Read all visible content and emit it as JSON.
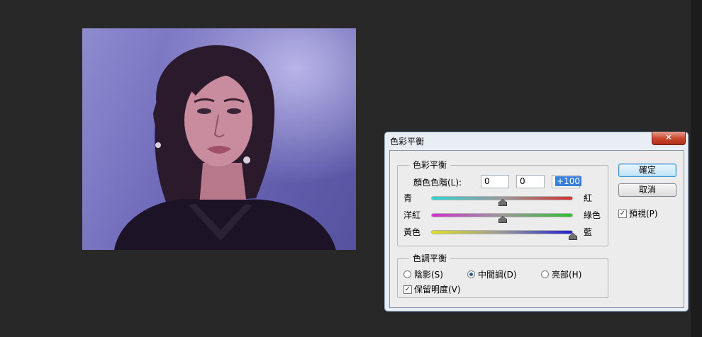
{
  "dialog": {
    "title": "色彩平衡",
    "close_label": "✕",
    "color_balance_group": {
      "label": "色彩平衡",
      "levels_label": "顏色色階(L):",
      "levels": [
        "0",
        "0",
        "+100"
      ],
      "sliders": [
        {
          "left": "青",
          "right": "紅",
          "value": 0
        },
        {
          "left": "洋紅",
          "right": "綠色",
          "value": 0
        },
        {
          "left": "黃色",
          "right": "藍",
          "value": 100
        }
      ]
    },
    "tone_balance_group": {
      "label": "色調平衡",
      "shadows": "陰影(S)",
      "midtones": "中間調(D)",
      "highlights": "亮部(H)",
      "selected": "midtones",
      "preserve_luminosity": "保留明度(V)",
      "preserve_luminosity_checked": true
    },
    "ok_label": "確定",
    "cancel_label": "取消",
    "preview_label": "預視(P)",
    "preview_checked": true
  },
  "colors": {
    "background": "#282828",
    "dialog_bg": "#ececec",
    "default_button": "#bde3f8"
  }
}
